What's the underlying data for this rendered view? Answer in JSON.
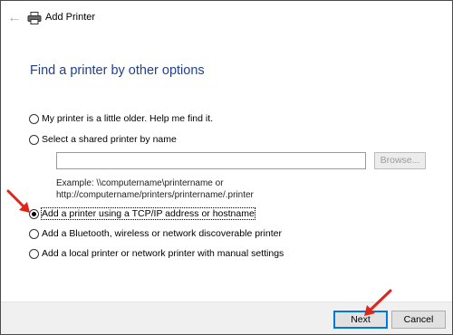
{
  "window": {
    "title": "Add Printer"
  },
  "page": {
    "heading": "Find a printer by other options"
  },
  "options": [
    {
      "label": "My printer is a little older. Help me find it.",
      "checked": false
    },
    {
      "label": "Select a shared printer by name",
      "checked": false
    },
    {
      "label": "Add a printer using a TCP/IP address or hostname",
      "checked": true
    },
    {
      "label": "Add a Bluetooth, wireless or network discoverable printer",
      "checked": false
    },
    {
      "label": "Add a local printer or network printer with manual settings",
      "checked": false
    }
  ],
  "shared_printer": {
    "input_value": "",
    "browse_label": "Browse...",
    "example_line1": "Example: \\\\computername\\printername or",
    "example_line2": "http://computername/printers/printername/.printer"
  },
  "buttons": {
    "next_label": "Next",
    "cancel_label": "Cancel"
  },
  "colors": {
    "heading": "#1f3f8e",
    "annotation_arrow": "#e0241b",
    "default_button_border": "#0078d7"
  },
  "icons": {
    "back": "back-arrow-icon",
    "printer": "printer-icon"
  }
}
